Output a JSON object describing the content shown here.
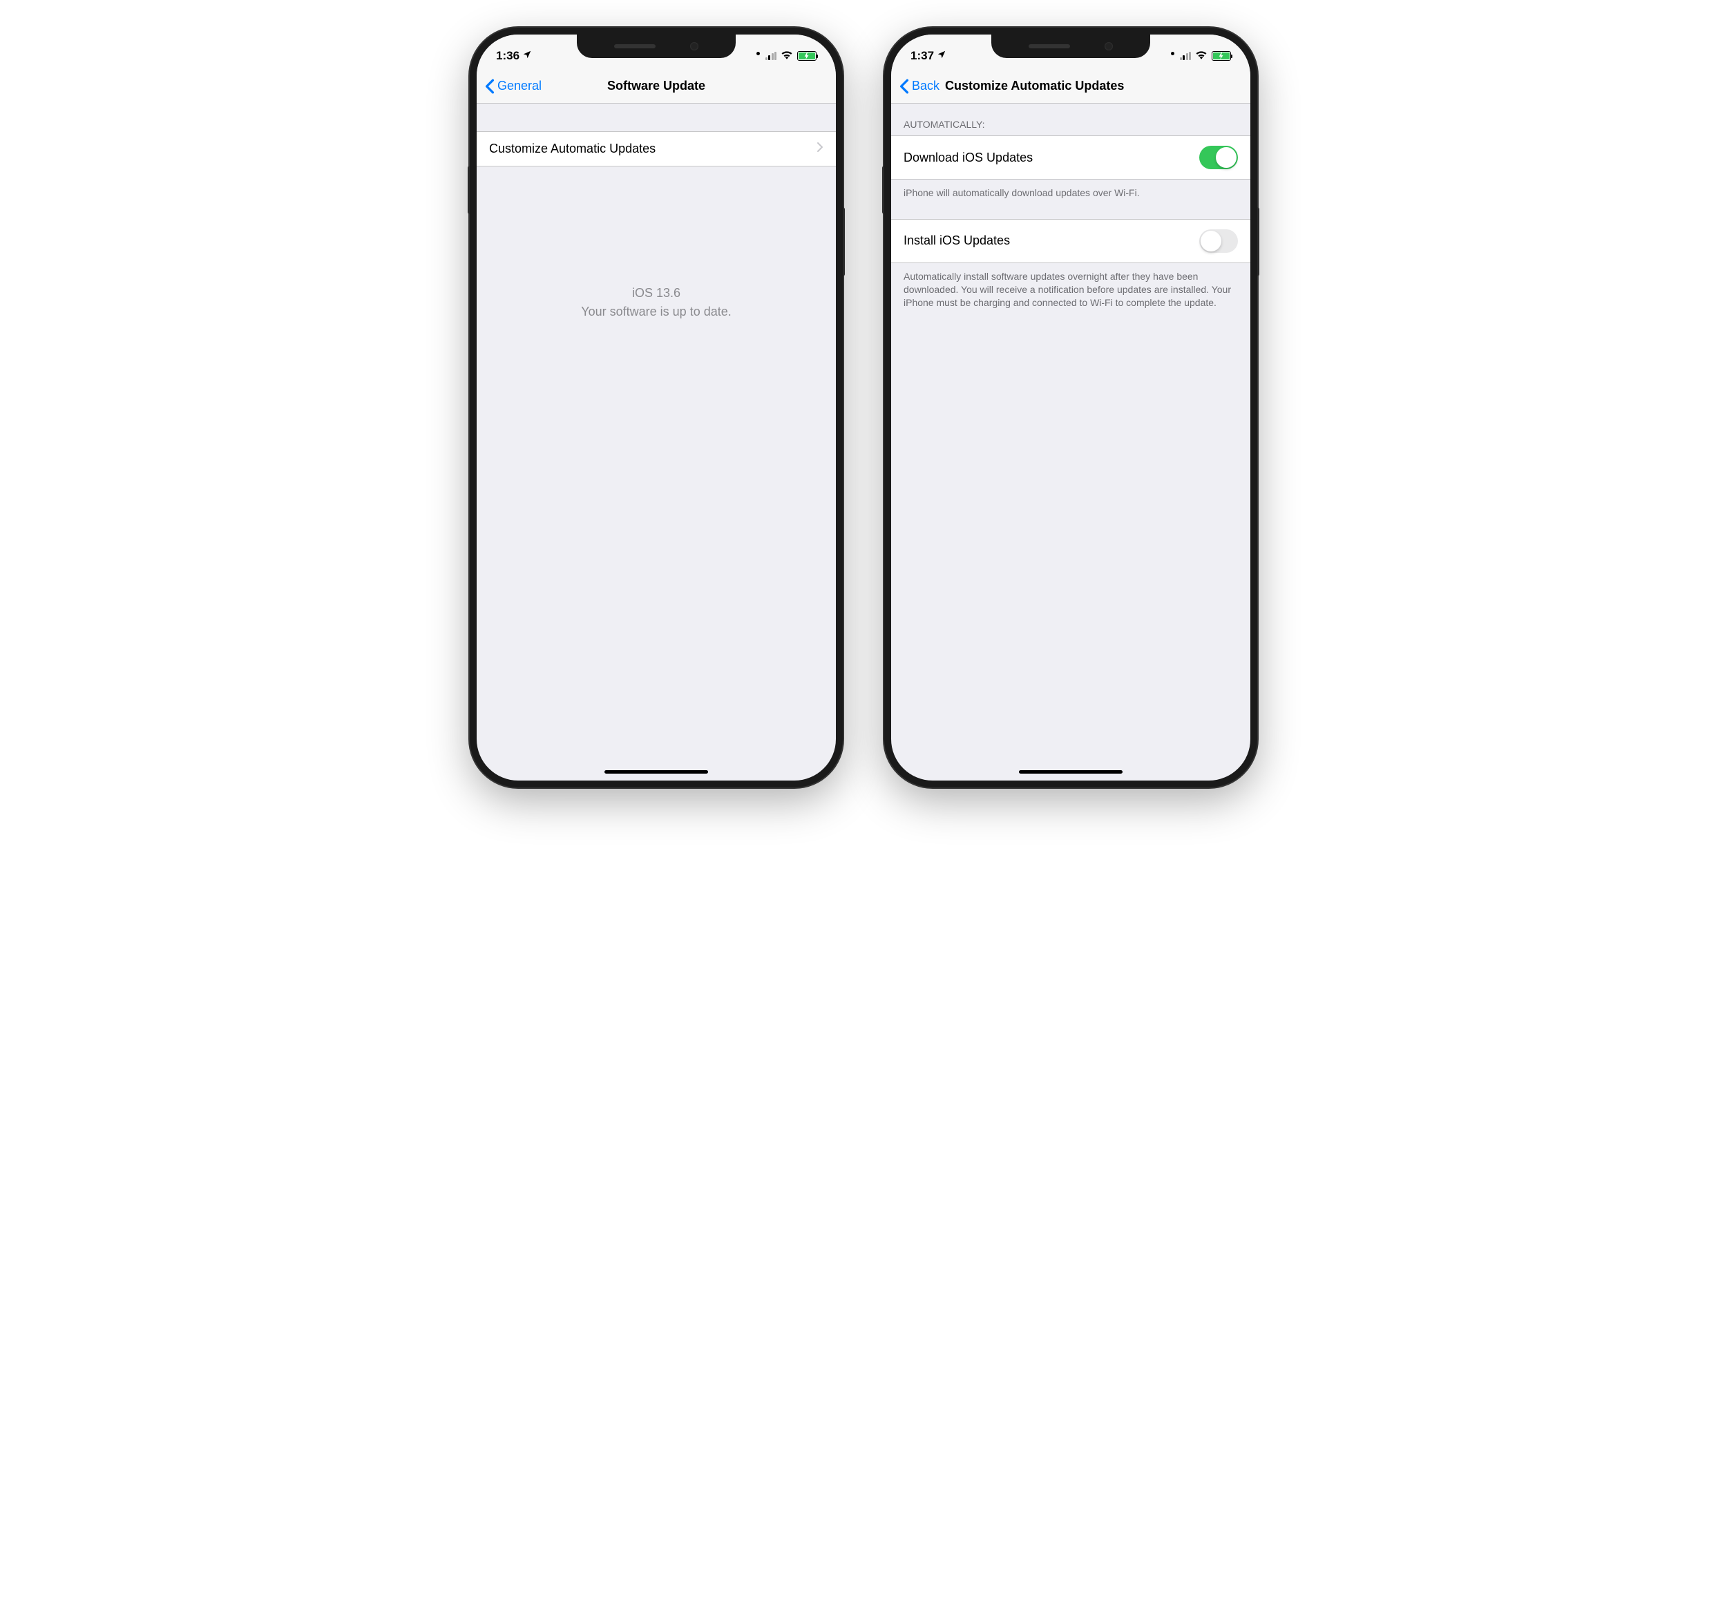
{
  "phone1": {
    "status": {
      "time": "1:36"
    },
    "nav": {
      "back": "General",
      "title": "Software Update"
    },
    "row_customize": "Customize Automatic Updates",
    "message_line1": "iOS 13.6",
    "message_line2": "Your software is up to date."
  },
  "phone2": {
    "status": {
      "time": "1:37"
    },
    "nav": {
      "back": "Back",
      "title": "Customize Automatic Updates"
    },
    "section_header": "Automatically:",
    "row_download": "Download iOS Updates",
    "download_footer": "iPhone will automatically download updates over Wi-Fi.",
    "row_install": "Install iOS Updates",
    "install_footer": "Automatically install software updates overnight after they have been downloaded. You will receive a notification before updates are installed. Your iPhone must be charging and connected to Wi-Fi to complete the update.",
    "download_on": true,
    "install_on": false
  }
}
